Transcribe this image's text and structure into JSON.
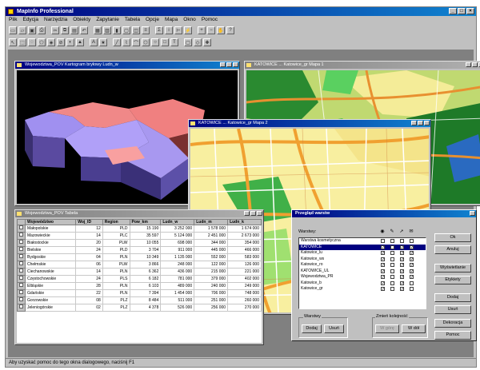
{
  "app": {
    "title": "MapInfo Professional",
    "window_controls": [
      "_",
      "□",
      "×"
    ]
  },
  "menu": [
    "Plik",
    "Edycja",
    "Narzędzia",
    "Obiekty",
    "Zapytanie",
    "Tabela",
    "Opcje",
    "Mapa",
    "Okno",
    "Pomoc"
  ],
  "toolbar1_icons": [
    "new-icon",
    "open-icon",
    "save-icon",
    "print-icon",
    "cut-icon",
    "copy-icon",
    "paste-icon",
    "undo-icon",
    "new-map-icon",
    "new-browser-icon",
    "new-graph-icon",
    "new-layout-icon",
    "redistrict-icon",
    "legend-icon",
    "statistics-icon",
    "info-icon",
    "ruler-icon",
    "hotlink-icon",
    "zoom-in-icon",
    "zoom-out-icon",
    "grabber-icon",
    "help-icon"
  ],
  "toolbar2_icons": [
    "select-icon",
    "marquee-icon",
    "radius-icon",
    "polygon-select-icon",
    "boundary-select-icon",
    "unselect-icon",
    "invert-icon",
    "graph-select-icon",
    "label-icon",
    "symbol-icon",
    "line-icon",
    "polyline-icon",
    "arc-icon",
    "polygon-icon",
    "ellipse-icon",
    "rectangle-icon",
    "text-icon",
    "frame-icon",
    "reshape-icon",
    "add-node-icon"
  ],
  "windows": {
    "w3d": {
      "title": "Wojewodztwa_POV Kartogram bryłowy Ludn_w"
    },
    "wmap1": {
      "title": "KATOWICE ... Katowice_gr Mapa 1"
    },
    "wmap2": {
      "title": "KATOWICE ... Katowice_gr Mapa 2"
    },
    "wtab": {
      "title": "Wojewodztwa_POV Tabela"
    }
  },
  "table": {
    "columns": [
      "",
      "Województwo",
      "Woj_ID",
      "Region",
      "Pow_km",
      "Ludn_w",
      "Ludn_m",
      "Ludn_k"
    ],
    "rows": [
      [
        "Małopolskie",
        "12",
        "PLD",
        "15 190",
        "3 252 000",
        "1 578 000",
        "1 674 000"
      ],
      [
        "Mazowieckie",
        "14",
        "PLC",
        "35 597",
        "5 124 000",
        "2 451 000",
        "2 673 000"
      ],
      [
        "Białostockie",
        "20",
        "PLW",
        "10 055",
        "698 000",
        "344 000",
        "354 000"
      ],
      [
        "Bielskie",
        "24",
        "PLD",
        "3 704",
        "911 000",
        "445 000",
        "466 000"
      ],
      [
        "Bydgoskie",
        "04",
        "PLN",
        "10 349",
        "1 135 000",
        "552 000",
        "583 000"
      ],
      [
        "Chełmskie",
        "06",
        "PLW",
        "3 866",
        "248 000",
        "122 000",
        "126 000"
      ],
      [
        "Ciechanowskie",
        "14",
        "PLN",
        "6 362",
        "436 000",
        "215 000",
        "221 000"
      ],
      [
        "Częstochowskie",
        "24",
        "PLS",
        "6 182",
        "781 000",
        "379 000",
        "402 000"
      ],
      [
        "Elbląskie",
        "28",
        "PLN",
        "6 103",
        "489 000",
        "240 000",
        "249 000"
      ],
      [
        "Gdańskie",
        "22",
        "PLN",
        "7 394",
        "1 454 000",
        "706 000",
        "748 000"
      ],
      [
        "Gorzowskie",
        "08",
        "PLZ",
        "8 484",
        "511 000",
        "251 000",
        "260 000"
      ],
      [
        "Jeleniogórskie",
        "02",
        "PLZ",
        "4 378",
        "526 000",
        "256 000",
        "270 000"
      ]
    ]
  },
  "dialog": {
    "title": "Przegląd warstw",
    "layers_label": "Warstwy:",
    "layers": [
      {
        "name": "Warstwa kosmetyczna",
        "selected": false
      },
      {
        "name": "KATOWICE",
        "selected": true
      },
      {
        "name": "Katowice_lu",
        "selected": false
      },
      {
        "name": "Katowice_ws",
        "selected": false
      },
      {
        "name": "Katowice_ro",
        "selected": false
      },
      {
        "name": "KATOWICE_UL",
        "selected": false
      },
      {
        "name": "Wojewodztwa_PR",
        "selected": false
      },
      {
        "name": "Katowice_b",
        "selected": false
      },
      {
        "name": "Katowice_gr",
        "selected": false
      }
    ],
    "column_icons": [
      "eye-icon",
      "pencil-icon",
      "select-arrow-icon",
      "label-icon"
    ],
    "buttons_right": [
      "Ok",
      "Anuluj",
      "Wyświetlanie",
      "Etykiety",
      "Dodaj",
      "Usuń",
      "Dekoracja",
      "Pomoc"
    ],
    "group_bottom_left": "Warstwy",
    "buttons_bottom_left": [
      "Dodaj",
      "Usuń"
    ],
    "group_bottom_right": "Zmień kolejność",
    "buttons_bottom_right": [
      "W górę",
      "W dół"
    ]
  },
  "status": "Aby uzyskać pomoc do tego okna dialogowego, naciśnij F1",
  "colors": {
    "title_active": "#000080",
    "map_road": "#f0a030",
    "map_urban": "#f8efa0",
    "map_green": "#33a040",
    "region_pink": "#e87a7a",
    "region_purple": "#9080e0"
  }
}
